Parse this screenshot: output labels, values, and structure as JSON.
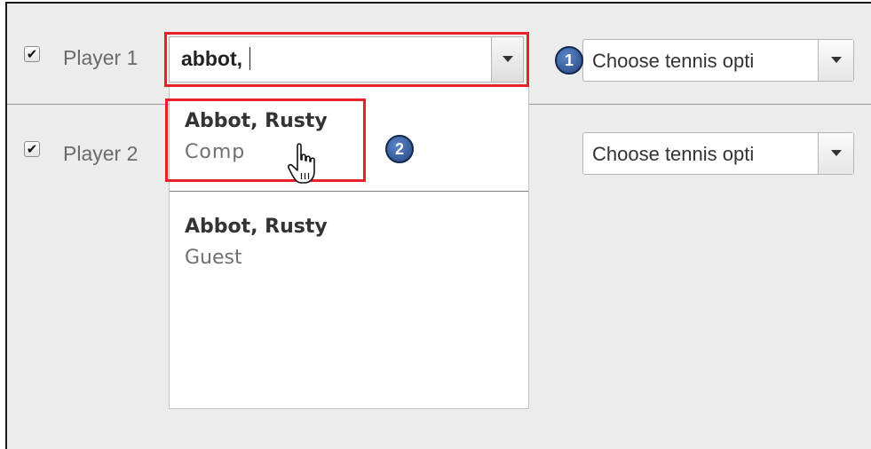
{
  "rows": [
    {
      "label": "Player 1",
      "checked": "✔",
      "input_value": "abbot,",
      "tennis_select": "Choose tennis opti"
    },
    {
      "label": "Player 2",
      "checked": "✔",
      "tennis_select": "Choose tennis opti"
    }
  ],
  "dropdown": {
    "options": [
      {
        "name": "Abbot, Rusty",
        "type": "Comp"
      },
      {
        "name": "Abbot, Rusty",
        "type": "Guest"
      }
    ]
  },
  "callouts": {
    "step1": "1",
    "step2": "2",
    "highlight_color": "#e8202a",
    "badge_color": "#2f5597"
  },
  "icons": {
    "checkbox": "checkmark-icon",
    "dropdown": "chevron-down-icon",
    "cursor": "hand-pointer-icon"
  }
}
